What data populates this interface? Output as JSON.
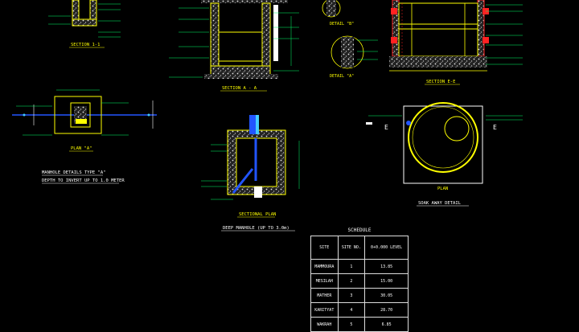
{
  "labels": {
    "section_1": "SECTION 1-1",
    "section_aa": "SECTION A - A",
    "detail_b": "DETAIL \"B\"",
    "detail_a": "DETAIL \"A\"",
    "section_ee": "SECTION E-E",
    "plan_a": "PLAN \"A\"",
    "manhole_title": "MANHOLE DETAILS TYPE \"A\"",
    "manhole_sub": "DEPTH TO INVERT UP TO 1.0 METER",
    "sectional_plan": "SECTIONAL PLAN",
    "deep_manhole": "DEEP MANHOLE (UP TO 3.0m)",
    "plan": "PLAN",
    "soakaway": "SOAK AWAY DETAIL"
  },
  "schedule": {
    "title": "SCHEDULE",
    "headers": [
      "SITE",
      "SITE NO.",
      "0+0.000 LEVEL"
    ],
    "rows": [
      [
        "MAMMOURA",
        "1",
        "13.85"
      ],
      [
        "MESILAH",
        "2",
        "15.00"
      ],
      [
        "MATHER",
        "3",
        "30.05"
      ],
      [
        "KARITYAT",
        "4",
        "28.70"
      ],
      [
        "WAKRAH",
        "5",
        "6.85"
      ]
    ]
  },
  "colors": {
    "background": "#000000",
    "wall": "#ffff00",
    "concrete": "#d8d8d8",
    "pipe": "#2255ff",
    "pipe_light": "#44ccff",
    "dimension": "#00ff66",
    "marker": "#ff2222",
    "text": "#ffffff"
  }
}
